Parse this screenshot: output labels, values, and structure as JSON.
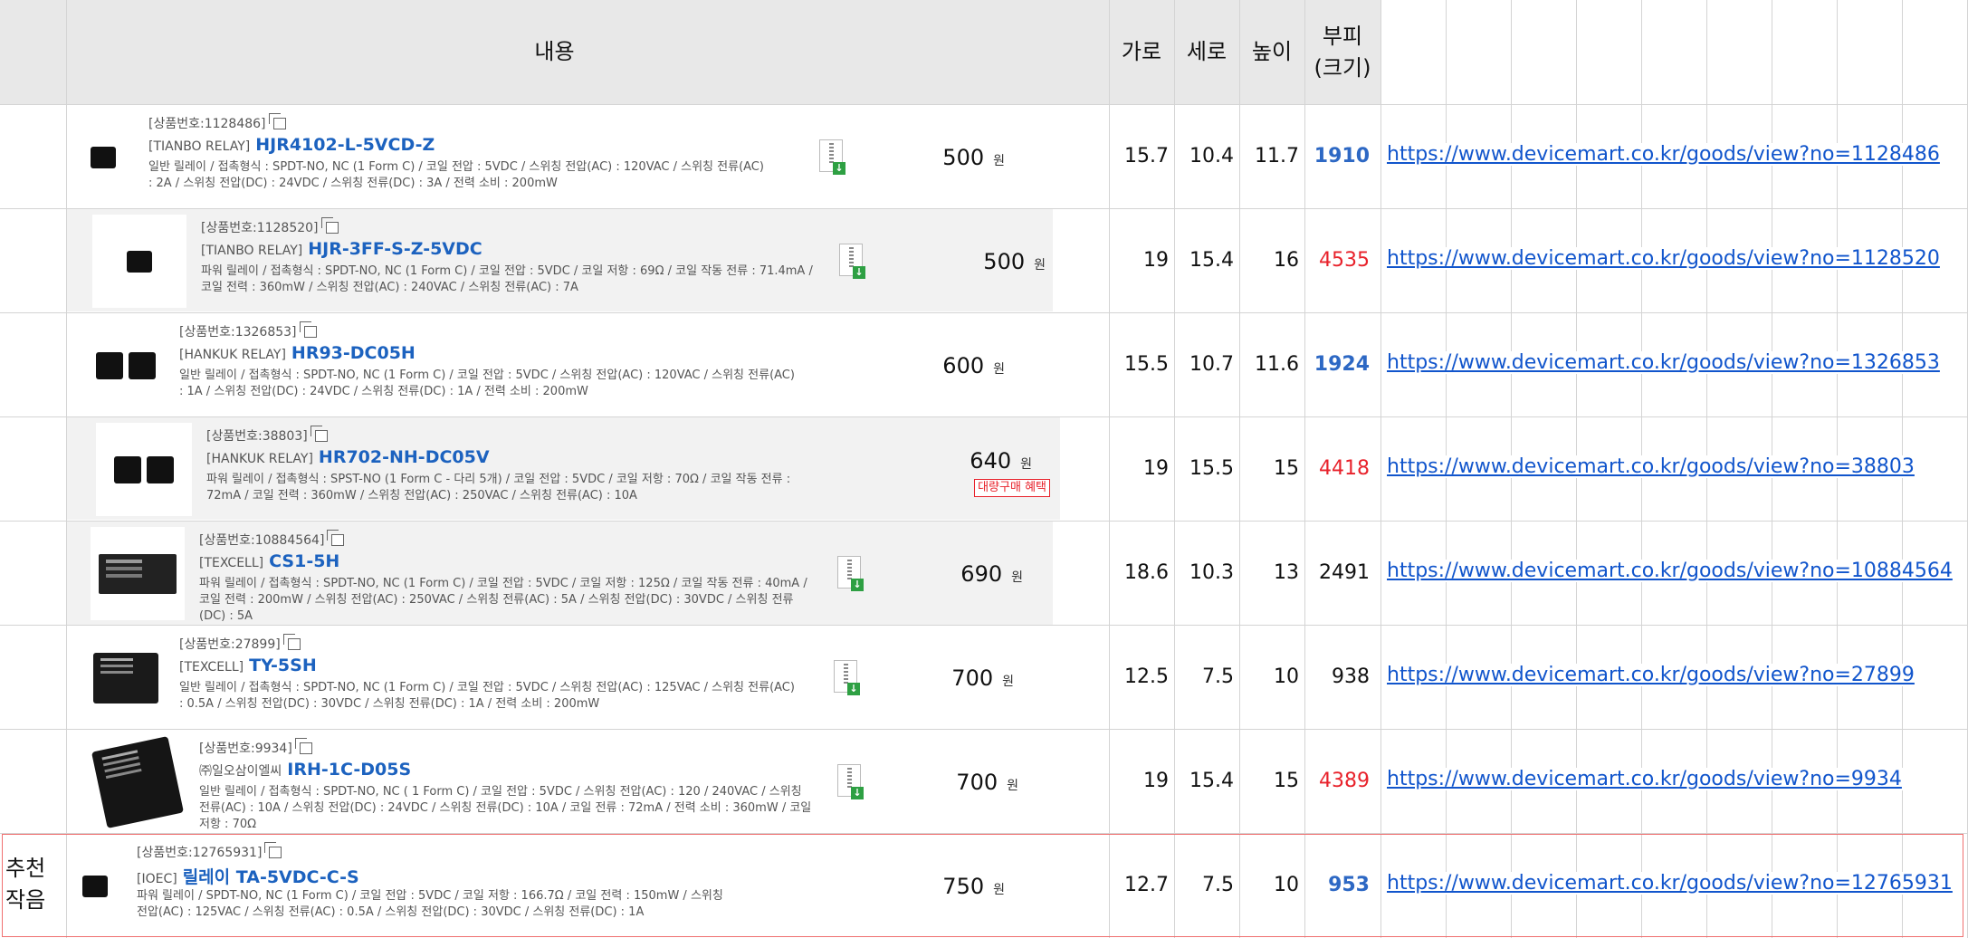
{
  "header": {
    "content": "내용",
    "width": "가로",
    "depth": "세로",
    "height": "높이",
    "volume_line1": "부피",
    "volume_line2": "(크기)"
  },
  "price_unit": "원",
  "bulk_badge": "대량구매 혜택",
  "recommend_label_line1": "추천",
  "recommend_label_line2": "작음",
  "colors": {
    "volume_blue": "#2d68c4",
    "volume_red": "#e8222b",
    "link": "#1155cc",
    "product_name": "#1c62bf",
    "recommend_border": "#f07070"
  },
  "rows": [
    {
      "code": "[상품번호:1128486]",
      "brand": "[TIANBO RELAY]",
      "name": "HJR4102-L-5VCD-Z",
      "desc": "일반 릴레이 / 접촉형식 : SPDT-NO, NC (1 Form C) / 코일 전압 : 5VDC / 스위칭 전압(AC) : 120VAC / 스위칭 전류(AC) : 2A / 스위칭 전압(DC) : 24VDC / 스위칭 전류(DC) : 3A / 전력 소비 : 200mW",
      "price": "500",
      "width": "15.7",
      "depth": "10.4",
      "height": "11.7",
      "volume": "1910",
      "volume_color": "blue",
      "url": "https://www.devicemart.co.kr/goods/view?no=1128486"
    },
    {
      "code": "[상품번호:1128520]",
      "brand": "[TIANBO RELAY]",
      "name": "HJR-3FF-S-Z-5VDC",
      "desc": "파워 릴레이 / 접촉형식 : SPDT-NO, NC (1 Form C) / 코일 전압 : 5VDC / 코일 저항 : 69Ω / 코일 작동 전류 : 71.4mA / 코일 전력 : 360mW / 스위칭 전압(AC) : 240VAC / 스위칭 전류(AC) : 7A",
      "price": "500",
      "width": "19",
      "depth": "15.4",
      "height": "16",
      "volume": "4535",
      "volume_color": "red",
      "url": "https://www.devicemart.co.kr/goods/view?no=1128520"
    },
    {
      "code": "[상품번호:1326853]",
      "brand": "[HANKUK RELAY]",
      "name": "HR93-DC05H",
      "desc": "일반 릴레이 / 접촉형식 : SPDT-NO, NC (1 Form C) / 코일 전압 : 5VDC / 스위칭 전압(AC) : 120VAC / 스위칭 전류(AC) : 1A / 스위칭 전압(DC) : 24VDC / 스위칭 전류(DC) : 1A / 전력 소비 : 200mW",
      "price": "600",
      "width": "15.5",
      "depth": "10.7",
      "height": "11.6",
      "volume": "1924",
      "volume_color": "blue",
      "url": "https://www.devicemart.co.kr/goods/view?no=1326853"
    },
    {
      "code": "[상품번호:38803]",
      "brand": "[HANKUK RELAY]",
      "name": "HR702-NH-DC05V",
      "desc": "파워 릴레이 / 접촉형식 : SPST-NO (1 Form C - 다리 5개) / 코일 전압 : 5VDC / 코일 저항 : 70Ω / 코일 작동 전류 : 72mA / 코일 전력 : 360mW / 스위칭 전압(AC) : 250VAC / 스위칭 전류(AC) : 10A",
      "price": "640",
      "width": "19",
      "depth": "15.5",
      "height": "15",
      "volume": "4418",
      "volume_color": "red",
      "url": "https://www.devicemart.co.kr/goods/view?no=38803"
    },
    {
      "code": "[상품번호:10884564]",
      "brand": "[TEXCELL]",
      "name": "CS1-5H",
      "desc": "파워 릴레이 / 접촉형식 : SPDT-NO, NC (1 Form C) / 코일 전압 : 5VDC / 코일 저항 : 125Ω / 코일 작동 전류 : 40mA / 코일 전력 : 200mW / 스위칭 전압(AC) : 250VAC / 스위칭 전류(AC) : 5A / 스위칭 전압(DC) : 30VDC / 스위칭 전류(DC) : 5A",
      "price": "690",
      "width": "18.6",
      "depth": "10.3",
      "height": "13",
      "volume": "2491",
      "volume_color": "black",
      "url": "https://www.devicemart.co.kr/goods/view?no=10884564"
    },
    {
      "code": "[상품번호:27899]",
      "brand": "[TEXCELL]",
      "name": "TY-5SH",
      "desc": "일반 릴레이 / 접촉형식 : SPDT-NO, NC (1 Form C) / 코일 전압 : 5VDC / 스위칭 전압(AC) : 125VAC / 스위칭 전류(AC) : 0.5A / 스위칭 전압(DC) : 30VDC / 스위칭 전류(DC) : 1A / 전력 소비 : 200mW",
      "price": "700",
      "width": "12.5",
      "depth": "7.5",
      "height": "10",
      "volume": "938",
      "volume_color": "black",
      "url": "https://www.devicemart.co.kr/goods/view?no=27899"
    },
    {
      "code": "[상품번호:9934]",
      "brand": "㈜일오삼이엘씨",
      "name": "IRH-1C-D05S",
      "desc": "일반 릴레이 / 접촉형식 : SPDT-NO, NC ( 1 Form C) / 코일 전압 : 5VDC / 스위칭 전압(AC) : 120 / 240VAC / 스위칭 전류(AC) : 10A / 스위칭 전압(DC) : 24VDC / 스위칭 전류(DC) : 10A / 코일 전류 : 72mA / 전력 소비 : 360mW / 코일 저항 : 70Ω",
      "price": "700",
      "width": "19",
      "depth": "15.4",
      "height": "15",
      "volume": "4389",
      "volume_color": "red",
      "url": "https://www.devicemart.co.kr/goods/view?no=9934"
    },
    {
      "code": "[상품번호:12765931]",
      "brand": "[IOEC]",
      "name": "릴레이 TA-5VDC-C-S",
      "desc": "파워 릴레이 / SPDT-NO, NC (1 Form C) / 코일 전압 : 5VDC / 코일 저항 : 166.7Ω / 코일 전력 : 150mW / 스위칭 전압(AC) : 125VAC / 스위칭 전류(AC) : 0.5A / 스위칭 전압(DC) : 30VDC / 스위칭 전류(DC) : 1A",
      "price": "750",
      "width": "12.7",
      "depth": "7.5",
      "height": "10",
      "volume": "953",
      "volume_color": "blue",
      "url": "https://www.devicemart.co.kr/goods/view?no=12765931"
    }
  ]
}
